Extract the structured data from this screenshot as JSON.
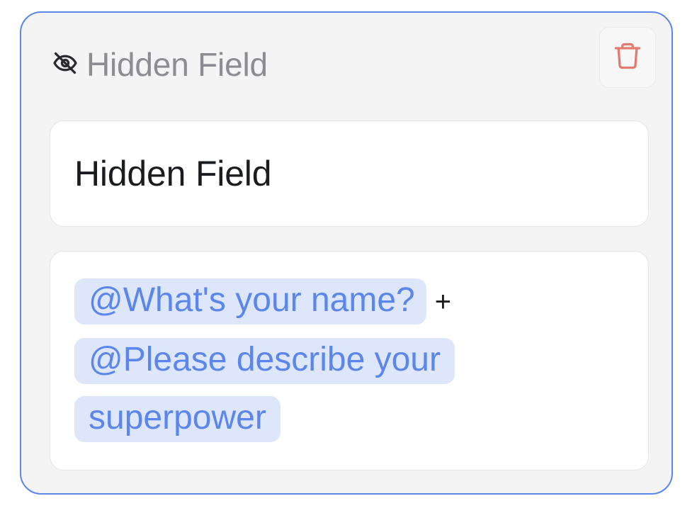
{
  "field_card": {
    "header": {
      "icon": "eye-off-icon",
      "title": "Hidden Field"
    },
    "delete_button": {
      "icon": "trash-icon",
      "color": "#e07b6f"
    },
    "name_input": {
      "value": "Hidden Field"
    },
    "value_input": {
      "mentions": [
        "@What's your name?",
        "@Please describe your superpower"
      ],
      "operator": "+"
    },
    "colors": {
      "border_accent": "#5b86ec",
      "mention_background": "#dde6fb",
      "mention_text": "#5b86ec"
    }
  }
}
